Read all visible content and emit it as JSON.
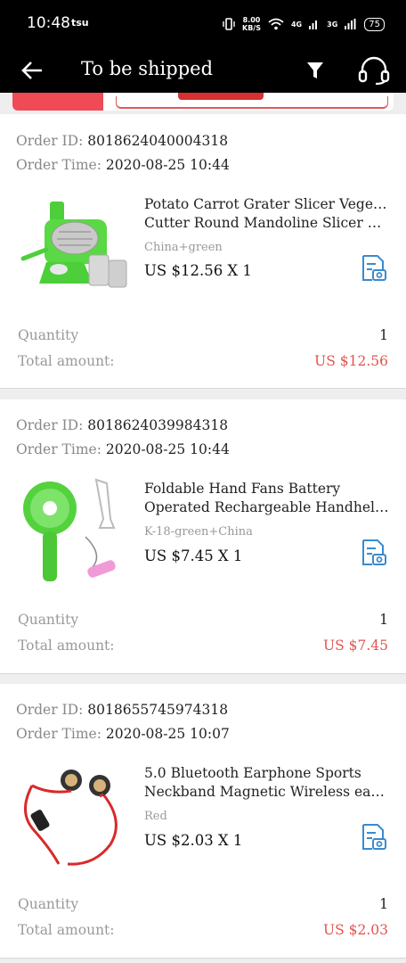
{
  "status_bar": {
    "time": "10:48",
    "carrier_icon": "tsu",
    "speed_value": "8.00",
    "speed_unit": "KB/S",
    "net_4g": "4G",
    "net_3g": "3G",
    "battery": "75"
  },
  "appbar": {
    "title": "To be shipped",
    "back_icon": "back-arrow-icon",
    "filter_icon": "filter-icon",
    "support_icon": "headset-icon"
  },
  "labels": {
    "order_id": "Order ID:",
    "order_time": "Order Time:",
    "quantity": "Quantity",
    "total_amount": "Total amount:"
  },
  "colors": {
    "header_bg": "#000000",
    "price_red": "#e0554f",
    "accent_blue": "#3a8ad0"
  },
  "orders": [
    {
      "id": "8018624040004318",
      "time": "2020-08-25 10:44",
      "name_line1": "Potato Carrot Grater Slicer Vegetable",
      "name_line2": "Cutter Round Mandoline Slicer Sta…",
      "variant": "China+green",
      "price": "US $12.56 X 1",
      "quantity": "1",
      "total": "US $12.56",
      "thumb": "green-grater-image"
    },
    {
      "id": "8018624039984318",
      "time": "2020-08-25 10:44",
      "name_line1": "Foldable Hand Fans Battery",
      "name_line2": "Operated Rechargeable Handheld …",
      "variant": "K-18-green+China",
      "price": "US $7.45 X 1",
      "quantity": "1",
      "total": "US $7.45",
      "thumb": "green-fan-image"
    },
    {
      "id": "8018655745974318",
      "time": "2020-08-25 10:07",
      "name_line1": "5.0 Bluetooth Earphone Sports",
      "name_line2": "Neckband Magnetic Wireless earph…",
      "variant": "Red",
      "price": "US $2.03 X 1",
      "quantity": "1",
      "total": "US $2.03",
      "thumb": "red-earphone-image"
    }
  ]
}
